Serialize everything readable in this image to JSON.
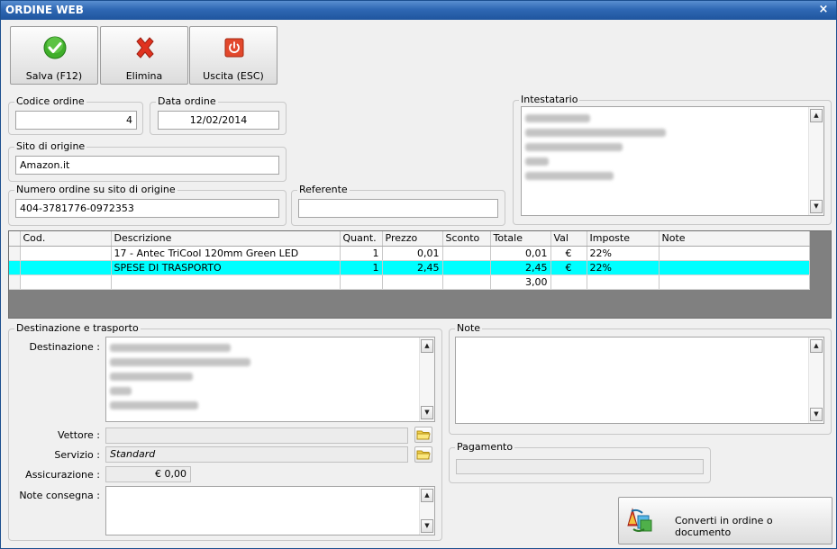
{
  "window": {
    "title": "ORDINE WEB",
    "close_glyph": "×"
  },
  "toolbar": {
    "save_label": "Salva (F12)",
    "delete_label": "Elimina",
    "exit_label": "Uscita (ESC)"
  },
  "order": {
    "code_title": "Codice ordine",
    "code_value": "4",
    "date_title": "Data ordine",
    "date_value": "12/02/2014",
    "site_title": "Sito di origine",
    "site_value": "Amazon.it",
    "ext_number_title": "Numero ordine su sito di origine",
    "ext_number_value": "404-3781776-0972353",
    "referent_title": "Referente",
    "referent_value": "",
    "holder_title": "Intestatario"
  },
  "grid": {
    "columns": [
      "Cod.",
      "Descrizione",
      "Quant.",
      "Prezzo",
      "Sconto",
      "Totale",
      "Val",
      "Imposte",
      "Note"
    ],
    "rows": [
      {
        "cod": "",
        "descrizione": "17 - Antec  TriCool 120mm Green LED",
        "quant": "1",
        "prezzo": "0,01",
        "sconto": "",
        "totale": "0,01",
        "val": "€",
        "imposte": "22%",
        "note": ""
      },
      {
        "cod": "",
        "descrizione": "SPESE DI TRASPORTO",
        "quant": "1",
        "prezzo": "2,45",
        "sconto": "",
        "totale": "2,45",
        "val": "€",
        "imposte": "22%",
        "note": ""
      }
    ],
    "total_row": {
      "totale": "3,00"
    }
  },
  "shipping": {
    "group_title": "Destinazione e trasporto",
    "destination_label": "Destinazione :",
    "carrier_label": "Vettore :",
    "carrier_value": "",
    "service_label": "Servizio :",
    "service_value": "Standard",
    "insurance_label": "Assicurazione :",
    "insurance_value": "€ 0,00",
    "delivery_notes_label": "Note consegna :"
  },
  "notes": {
    "group_title": "Note"
  },
  "payment": {
    "group_title": "Pagamento",
    "value": ""
  },
  "convert": {
    "label": "Converti in ordine o documento"
  },
  "colors": {
    "title_bar": "#2f68b4",
    "selected_row": "#00ffff",
    "grid_background": "#808080"
  },
  "icons": {
    "save": "check-icon",
    "delete": "x-icon",
    "exit": "power-icon",
    "browse": "folder-icon",
    "convert": "convert-arrows-icon"
  }
}
